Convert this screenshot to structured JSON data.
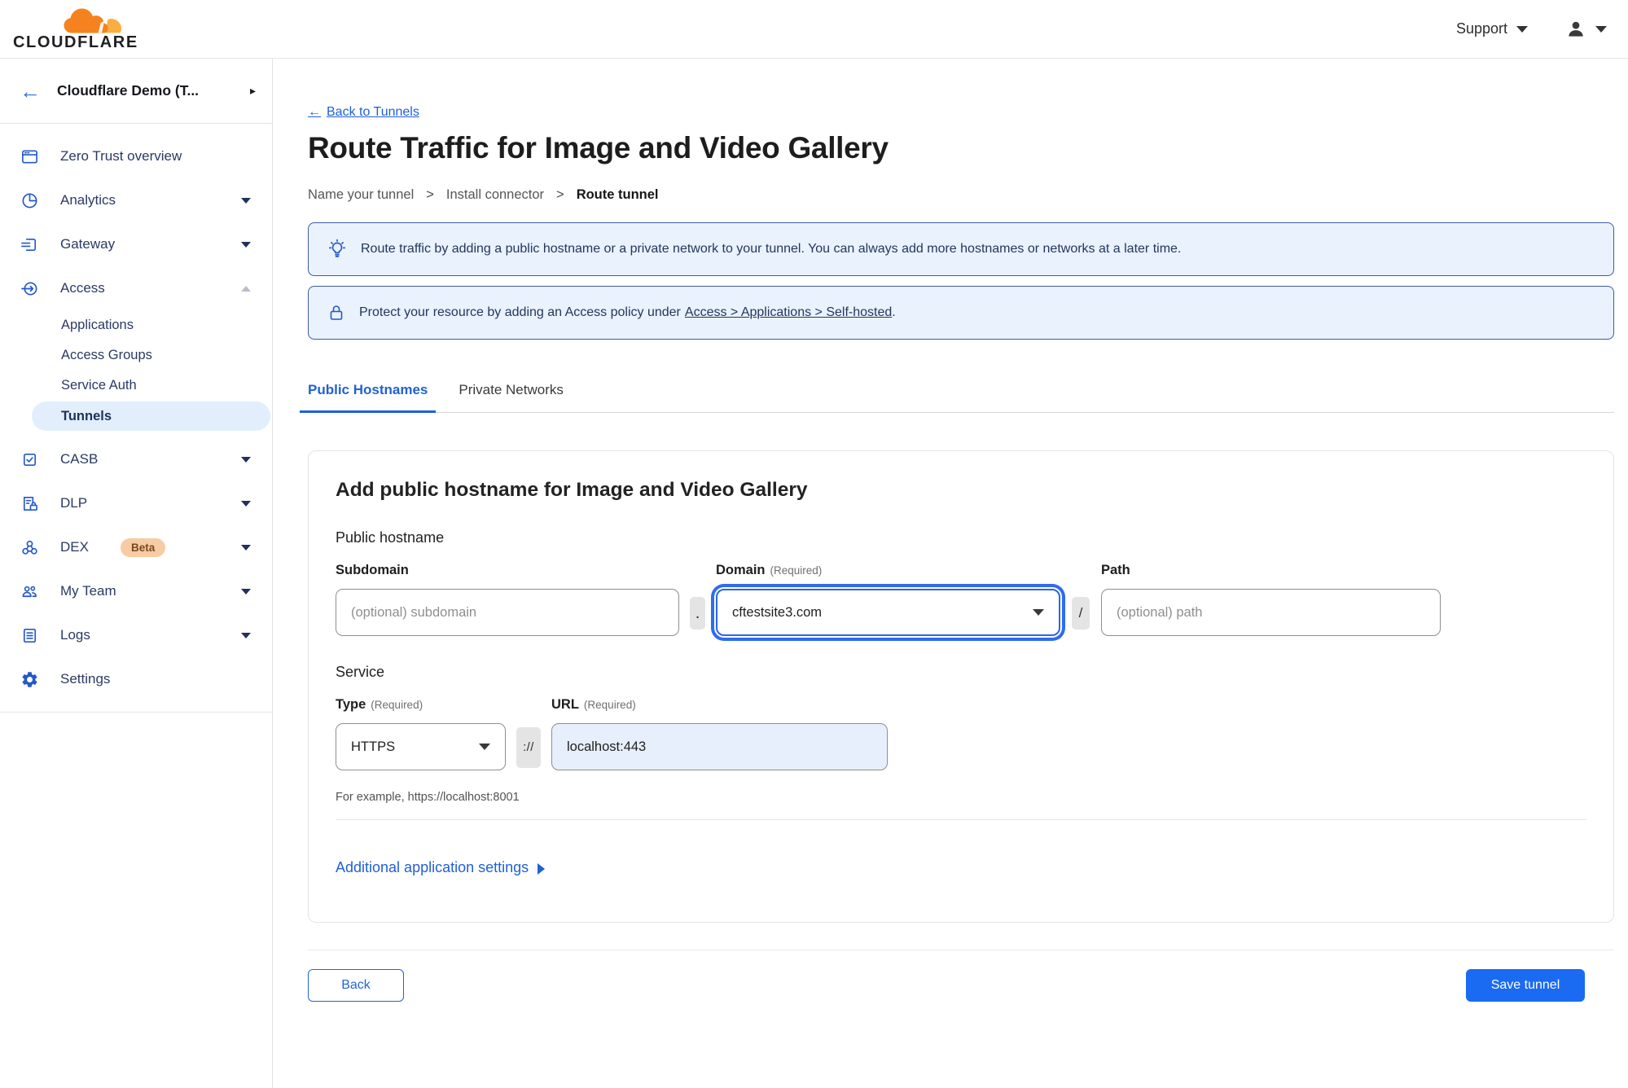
{
  "topbar": {
    "support_label": "Support"
  },
  "sidebar": {
    "account_name": "Cloudflare Demo (T...",
    "back_glyph": "←",
    "chevron_glyph": "▸",
    "nav": [
      {
        "label": "Zero Trust overview"
      },
      {
        "label": "Analytics"
      },
      {
        "label": "Gateway"
      },
      {
        "label": "Access"
      },
      {
        "label": "Applications"
      },
      {
        "label": "Access Groups"
      },
      {
        "label": "Service Auth"
      },
      {
        "label": "Tunnels"
      },
      {
        "label": "CASB"
      },
      {
        "label": "DLP"
      },
      {
        "label": "DEX",
        "badge": "Beta"
      },
      {
        "label": "My Team"
      },
      {
        "label": "Logs"
      },
      {
        "label": "Settings"
      }
    ]
  },
  "main": {
    "back_arrow": "←",
    "back_link": "Back to Tunnels",
    "title": "Route Traffic for Image and Video Gallery",
    "breadcrumb": {
      "steps": [
        "Name your tunnel",
        "Install connector",
        "Route tunnel"
      ],
      "separator": ">"
    },
    "banners": {
      "tip": "Route traffic by adding a public hostname or a private network to your tunnel. You can always add more hostnames or networks at a later time.",
      "access_before": "Protect your resource by adding an Access policy under",
      "access_link": "Access > Applications > Self-hosted",
      "access_after": "."
    },
    "tabs": [
      {
        "label": "Public Hostnames"
      },
      {
        "label": "Private Networks"
      }
    ],
    "card": {
      "heading": "Add public hostname for Image and Video Gallery",
      "public_hostname_label": "Public hostname",
      "subdomain_label": "Subdomain",
      "subdomain_placeholder": "(optional) subdomain",
      "dot_separator": ".",
      "domain_label": "Domain",
      "domain_required": "(Required)",
      "domain_value": "cftestsite3.com",
      "slash_separator": "/",
      "path_label": "Path",
      "path_placeholder": "(optional) path",
      "service_label": "Service",
      "type_label": "Type",
      "type_required": "(Required)",
      "type_value": "HTTPS",
      "scheme_separator": "://",
      "url_label": "URL",
      "url_required": "(Required)",
      "url_value": "localhost:443",
      "example_hint": "For example, https://localhost:8001",
      "additional_settings_label": "Additional application settings"
    },
    "footer": {
      "back_label": "Back",
      "save_label": "Save tunnel"
    }
  },
  "colors": {
    "accent_blue": "#2061d5",
    "button_blue": "#1a6bf2",
    "banner_background": "#e9f2fd",
    "banner_border": "#3b5ba9",
    "active_nav_background": "#e2eefb",
    "beta_badge_background": "#f7cba3",
    "beta_badge_text": "#7a4a20",
    "logo_orange": "#f6821f",
    "logo_light_orange": "#fbad41",
    "url_input_background": "#e7effc"
  }
}
